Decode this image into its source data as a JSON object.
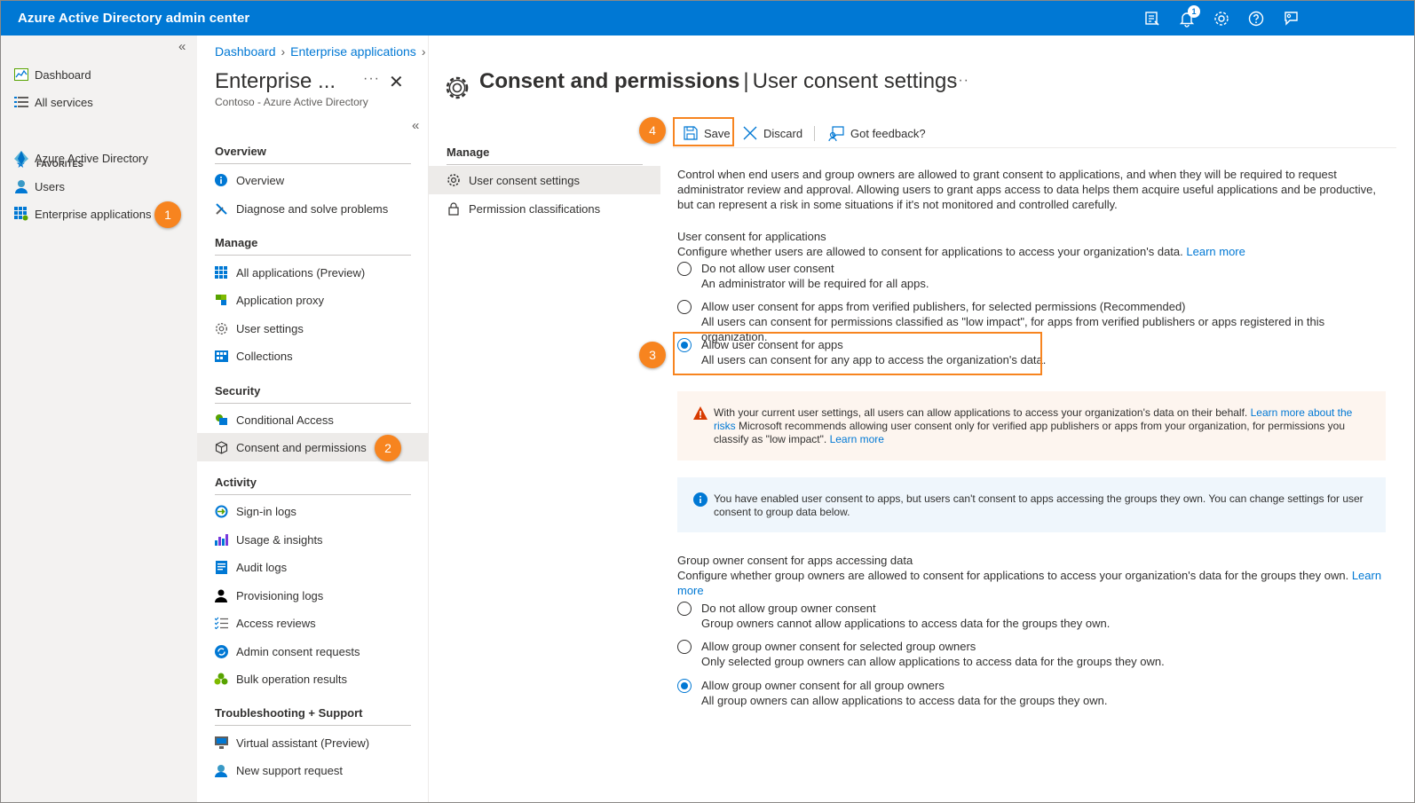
{
  "topbar": {
    "title": "Azure Active Directory admin center",
    "notification_count": "1",
    "icons": [
      "feedback-portal-icon",
      "bell-icon",
      "gear-icon",
      "help-icon",
      "feedback-icon"
    ]
  },
  "leftnav": {
    "collapse": "«",
    "items": [
      {
        "label": "Dashboard",
        "icon": "dashboard-icon"
      },
      {
        "label": "All services",
        "icon": "list-icon"
      }
    ],
    "favorites_label": "FAVORITES",
    "favorites": [
      {
        "label": "Azure Active Directory",
        "icon": "aad-icon"
      },
      {
        "label": "Users",
        "icon": "user-icon"
      },
      {
        "label": "Enterprise applications",
        "icon": "apps-grid-icon"
      }
    ]
  },
  "callouts": {
    "one": "1",
    "two": "2",
    "three": "3",
    "four": "4"
  },
  "breadcrumb": [
    "Dashboard",
    "Enterprise applications"
  ],
  "panel": {
    "title": "Enterprise ...",
    "subtitle": "Contoso - Azure Active Directory",
    "more": "···",
    "close": "✕",
    "collapse": "«",
    "sections": [
      {
        "header": "Overview",
        "items": [
          "Overview",
          "Diagnose and solve problems"
        ]
      },
      {
        "header": "Manage",
        "items": [
          "All applications (Preview)",
          "Application proxy",
          "User settings",
          "Collections"
        ]
      },
      {
        "header": "Security",
        "items": [
          "Conditional Access",
          "Consent and permissions"
        ]
      },
      {
        "header": "Activity",
        "items": [
          "Sign-in logs",
          "Usage & insights",
          "Audit logs",
          "Provisioning logs",
          "Access reviews",
          "Admin consent requests",
          "Bulk operation results"
        ]
      },
      {
        "header": "Troubleshooting + Support",
        "items": [
          "Virtual assistant (Preview)",
          "New support request"
        ]
      }
    ]
  },
  "main": {
    "title_bold": "Consent and permissions",
    "title_sep": "|",
    "title_rest": "User consent settings",
    "more": "···",
    "submenu_header": "Manage",
    "submenu": [
      "User consent settings",
      "Permission classifications"
    ],
    "toolbar": {
      "save": "Save",
      "discard": "Discard",
      "feedback": "Got feedback?"
    },
    "intro": "Control when end users and group owners are allowed to grant consent to applications, and when they will be required to request administrator review and approval. Allowing users to grant apps access to data helps them acquire useful applications and be productive, but can represent a risk in some situations if it's not monitored and controlled carefully.",
    "user_consent": {
      "heading": "User consent for applications",
      "desc": "Configure whether users are allowed to consent for applications to access your organization's data.",
      "learn_more": "Learn more",
      "options": [
        {
          "label": "Do not allow user consent",
          "desc": "An administrator will be required for all apps.",
          "selected": false
        },
        {
          "label": "Allow user consent for apps from verified publishers, for selected permissions (Recommended)",
          "desc": "All users can consent for permissions classified as \"low impact\", for apps from verified publishers or apps registered in this organization.",
          "selected": false
        },
        {
          "label": "Allow user consent for apps",
          "desc": "All users can consent for any app to access the organization's data.",
          "selected": true
        }
      ]
    },
    "warning": {
      "text1": "With your current user settings, all users can allow applications to access your organization's data on their behalf.",
      "link1": "Learn more about the risks",
      "text2": "Microsoft recommends allowing user consent only for verified app publishers or apps from your organization, for permissions you classify as \"low impact\".",
      "link2": "Learn more"
    },
    "info": {
      "text": "You have enabled user consent to apps, but users can't consent to apps accessing the groups they own. You can change settings for user consent to group data below."
    },
    "group_consent": {
      "heading": "Group owner consent for apps accessing data",
      "desc": "Configure whether group owners are allowed to consent for applications to access your organization's data for the groups they own.",
      "learn_more": "Learn more",
      "options": [
        {
          "label": "Do not allow group owner consent",
          "desc": "Group owners cannot allow applications to access data for the groups they own.",
          "selected": false
        },
        {
          "label": "Allow group owner consent for selected group owners",
          "desc": "Only selected group owners can allow applications to access data for the groups they own.",
          "selected": false
        },
        {
          "label": "Allow group owner consent for all group owners",
          "desc": "All group owners can allow applications to access data for the groups they own.",
          "selected": true
        }
      ]
    }
  },
  "colors": {
    "accent": "#0078d4",
    "callout": "#f7841f",
    "warning_bg": "#fdf5ef",
    "info_bg": "#eff6fc"
  }
}
